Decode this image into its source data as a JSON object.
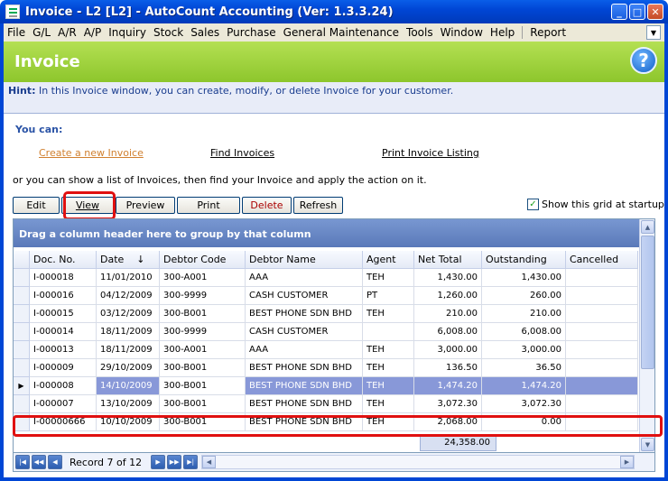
{
  "window": {
    "title": "Invoice - L2 [L2] - AutoCount Accounting (Ver: 1.3.3.24)"
  },
  "menu": [
    "File",
    "G/L",
    "A/R",
    "A/P",
    "Inquiry",
    "Stock",
    "Sales",
    "Purchase",
    "General Maintenance",
    "Tools",
    "Window",
    "Help",
    "Report"
  ],
  "header": {
    "title": "Invoice"
  },
  "hint": {
    "label": "Hint:",
    "text": "In this Invoice window, you can create, modify, or delete Invoice for your customer."
  },
  "you_can": "You can:",
  "links": {
    "create": "Create a new Invoice",
    "find": "Find Invoices",
    "print": "Print Invoice Listing"
  },
  "instruction": "or you can show a list of Invoices, then find your Invoice and apply the action on it.",
  "toolbar": {
    "edit": "Edit",
    "view": "View",
    "preview": "Preview",
    "print": "Print",
    "delete": "Delete",
    "refresh": "Refresh"
  },
  "startup": {
    "label": "Show this grid at startup",
    "checked": true
  },
  "grid": {
    "group_hint": "Drag a column header here to group by that column",
    "columns": [
      "Doc. No.",
      "Date",
      "Debtor Code",
      "Debtor Name",
      "Agent",
      "Net Total",
      "Outstanding",
      "Cancelled"
    ],
    "rows": [
      [
        "I-000018",
        "11/01/2010",
        "300-A001",
        "AAA",
        "TEH",
        "1,430.00",
        "1,430.00",
        ""
      ],
      [
        "I-000016",
        "04/12/2009",
        "300-9999",
        "CASH CUSTOMER",
        "PT",
        "1,260.00",
        "260.00",
        ""
      ],
      [
        "I-000015",
        "03/12/2009",
        "300-B001",
        "BEST PHONE SDN BHD",
        "TEH",
        "210.00",
        "210.00",
        ""
      ],
      [
        "I-000014",
        "18/11/2009",
        "300-9999",
        "CASH CUSTOMER",
        "",
        "6,008.00",
        "6,008.00",
        ""
      ],
      [
        "I-000013",
        "18/11/2009",
        "300-A001",
        "AAA",
        "TEH",
        "3,000.00",
        "3,000.00",
        ""
      ],
      [
        "I-000009",
        "29/10/2009",
        "300-B001",
        "BEST PHONE SDN BHD",
        "TEH",
        "136.50",
        "36.50",
        ""
      ],
      [
        "I-000008",
        "14/10/2009",
        "300-B001",
        "BEST PHONE SDN BHD",
        "TEH",
        "1,474.20",
        "1,474.20",
        ""
      ],
      [
        "I-000007",
        "13/10/2009",
        "300-B001",
        "BEST PHONE SDN BHD",
        "TEH",
        "3,072.30",
        "3,072.30",
        ""
      ],
      [
        "I-00000666",
        "10/10/2009",
        "300-B001",
        "BEST PHONE SDN BHD",
        "TEH",
        "2,068.00",
        "0.00",
        ""
      ]
    ],
    "selected_row": 6,
    "net_total_sum": "24,358.00"
  },
  "nav": {
    "record": "Record 7 of 12"
  }
}
